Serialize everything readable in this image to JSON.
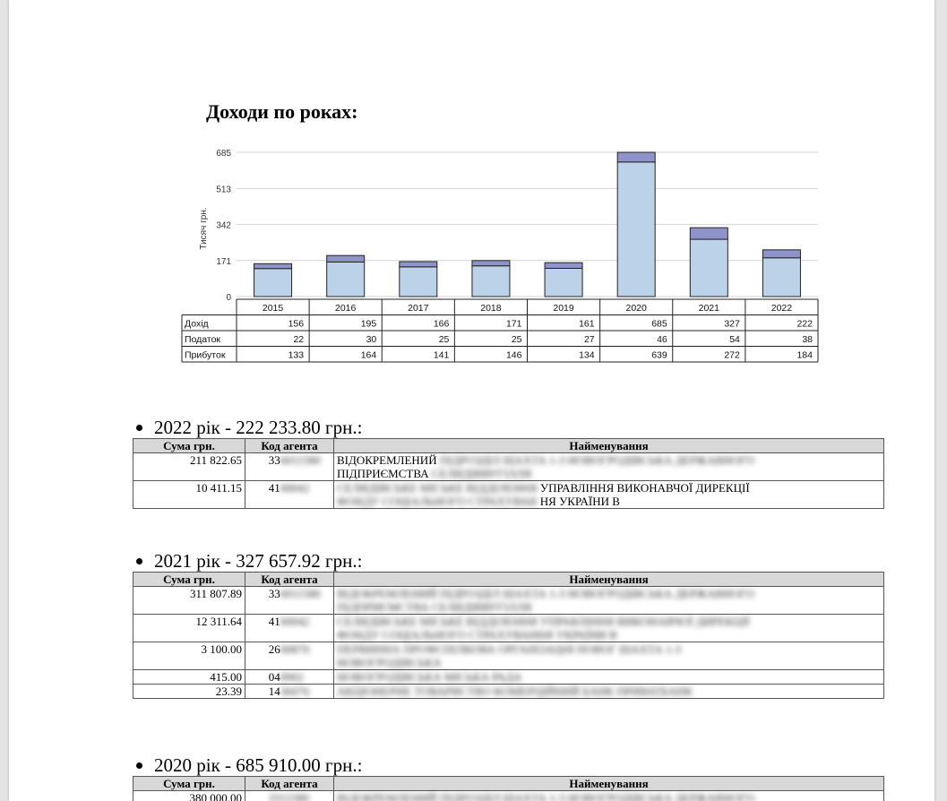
{
  "heading": "Доходи по роках:",
  "chart_data": {
    "type": "bar",
    "ylabel": "Тисяч грн.",
    "yticks": [
      0,
      171,
      342,
      513,
      685
    ],
    "ylim": [
      0,
      685
    ],
    "categories": [
      "2015",
      "2016",
      "2017",
      "2018",
      "2019",
      "2020",
      "2021",
      "2022"
    ],
    "series": [
      {
        "name": "Дохід",
        "values": [
          156,
          195,
          166,
          171,
          161,
          685,
          327,
          222
        ]
      },
      {
        "name": "Податок",
        "values": [
          22,
          30,
          25,
          25,
          27,
          46,
          54,
          38
        ]
      },
      {
        "name": "Прибуток",
        "values": [
          133,
          164,
          141,
          146,
          134,
          639,
          272,
          184
        ]
      }
    ],
    "colors": {
      "profit": "#bcd2e8",
      "tax": "#8e93c9"
    }
  },
  "sections": [
    {
      "heading": "2022 рік - 222 233.80 грн.:",
      "headers": [
        "Сума грн.",
        "Код агента",
        "Найменування"
      ],
      "rows": [
        {
          "sum": "211 822.65",
          "code_visible": "33",
          "code_hidden": "6011580",
          "name_visible": "ВІДОКРЕМЛЕНИЙ",
          "name_hidden": "ПІДРОЗДІЛ ШАХТА 1-3 НОВОГРОДІВСЬКА ДЕРЖАВНОГО",
          "name2_visible": "ПІДПРИЄМСТВА",
          "name2_hidden": "СЕЛИДІВВУГІЛЛЯ"
        },
        {
          "sum": "10 411.15",
          "code_visible": "41",
          "code_hidden": "00042",
          "name_hidden": "СЕЛИДІВСЬКЕ МІСЬКЕ ВІДДІЛЕННЯ",
          "name_visible": "УПРАВЛІННЯ ВИКОНАВЧОЇ ДИРЕКЦІЇ",
          "name2_hidden": "ФОНДУ СОЦІАЛЬНОГО СТРАХУВАН",
          "name2_visible": "НЯ УКРАЇНИ В"
        }
      ]
    },
    {
      "heading": "2021 рік - 327 657.92 грн.:",
      "headers": [
        "Сума грн.",
        "Код агента",
        "Найменування"
      ],
      "rows": [
        {
          "sum": "311 807.89",
          "code_visible": "33",
          "code_hidden": "6011580",
          "name_hidden": "ВІДОКРЕМЛЕНИЙ ПІДРОЗДІЛ ШАХТА 1-3 НОВОГРОДІВСЬКА ДЕРЖАВНОГО",
          "name2_hidden": "ПІДПРИЄМСТВА СЕЛИДІВВУГІЛЛЯ"
        },
        {
          "sum": "12 311.64",
          "code_visible": "41",
          "code_hidden": "00042",
          "name_hidden": "СЕЛИДІВСЬКЕ МІСЬКЕ ВІДДІЛЕННЯ УПРАВЛІННЯ ВИКОНАВЧОЇ ДИРЕКЦІЇ",
          "name2_hidden": "ФОНДУ СОЦІАЛЬНОГО СТРАХУВАННЯ УКРАЇНИ В"
        },
        {
          "sum": "3 100.00",
          "code_visible": "26",
          "code_hidden": "00870",
          "name_hidden": "ПЕРВИННА ПРОФСПІЛКОВА ОРГАНІЗАЦІЯ ПОВОГ ШАХТА 1-3",
          "name2_hidden": "НОВОГРОДІВСЬКА"
        },
        {
          "sum": "415.00",
          "code_visible": "04",
          "code_hidden": "0902",
          "name_hidden": "НОВОГРОДІВСЬКА МІСЬКА РАДА"
        },
        {
          "sum": "23.39",
          "code_visible": "14",
          "code_hidden": "36076",
          "name_hidden": "АКЦІОНЕРНЕ ТОВАРИСТВО КОМЕРЦІЙНИЙ БАНК ПРИВАТБАНК"
        }
      ]
    },
    {
      "heading": "2020 рік - 685 910.00 грн.:",
      "headers": [
        "Сума грн.",
        "Код агента",
        "Найменування"
      ],
      "rows": [
        {
          "sum": "380 000.00",
          "code_visible": "",
          "code_hidden": "3311580",
          "name_hidden": "ВІДОКРЕМЛЕНИЙ ПІДРОЗДІЛ ШАХТА 1-3 НОВОГРОДІВСЬКА ДЕРЖАВНОГО"
        }
      ]
    }
  ]
}
